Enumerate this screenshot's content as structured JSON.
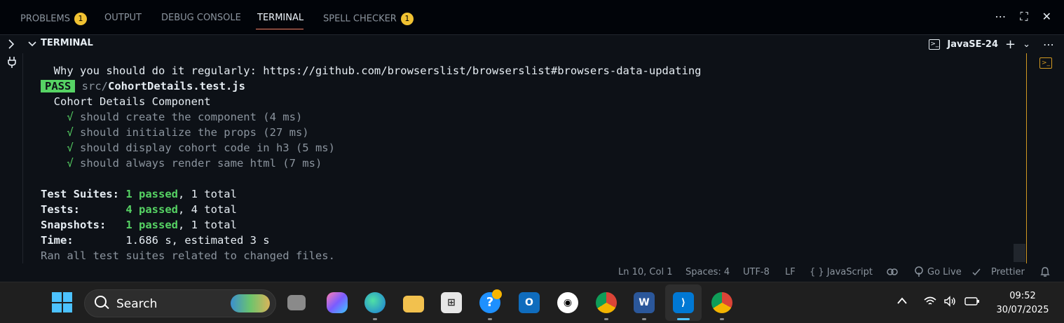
{
  "panel_tabs": [
    {
      "label": "PROBLEMS",
      "badge": "1"
    },
    {
      "label": "OUTPUT"
    },
    {
      "label": "DEBUG CONSOLE"
    },
    {
      "label": "TERMINAL"
    },
    {
      "label": "SPELL CHECKER",
      "badge": "1"
    }
  ],
  "panel_actions": {
    "more": "⋯",
    "maximize": "⛶",
    "close": "✕"
  },
  "terminal": {
    "header": "TERMINAL",
    "profile": "JavaSE-24",
    "add": "+",
    "dropdown": "⌄",
    "more": "⋯",
    "lines": {
      "l1": "  Why you should do it regularly: https://github.com/browserslist/browserslist#browsers-data-updating",
      "pass_badge": "PASS",
      "pass_dir": "src/",
      "pass_file": "CohortDetails.test.js",
      "describe": "  Cohort Details Component",
      "check": "√",
      "t1": " should create the component (4 ms)",
      "t2": " should initialize the props (27 ms)",
      "t3": " should display cohort code in h3 (5 ms)",
      "t4": " should always render same html (7 ms)",
      "suites_label": "Test Suites:",
      "suites_passed": "1 passed",
      "suites_total": ", 1 total",
      "tests_label": "Tests:",
      "tests_passed": "4 passed",
      "tests_total": ", 4 total",
      "snap_label": "Snapshots:",
      "snap_passed": "1 passed",
      "snap_total": ", 1 total",
      "time_label": "Time:",
      "time_value": "1.686 s, estimated 3 s",
      "footer": "Ran all test suites related to changed files."
    }
  },
  "status_bar": {
    "position": "Ln 10, Col 1",
    "spaces": "Spaces: 4",
    "encoding": "UTF-8",
    "eol": "LF",
    "language": "{ } JavaScript",
    "golive": "Go Live",
    "prettier": "Prettier"
  },
  "taskbar": {
    "search_label": "Search",
    "time": "09:52",
    "date": "30/07/2025"
  }
}
